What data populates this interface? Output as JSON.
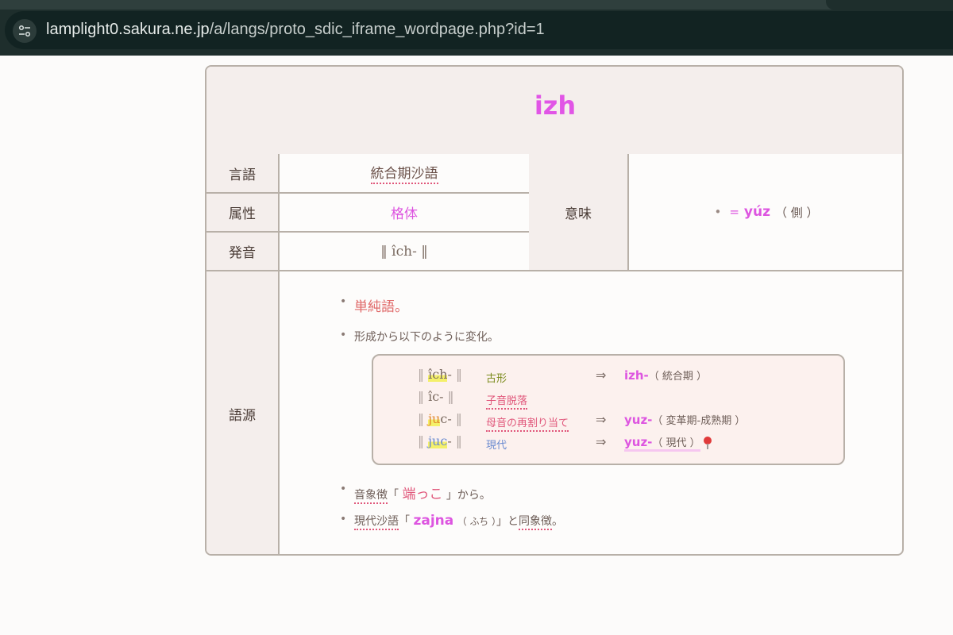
{
  "browser": {
    "url_host": "lamplight0.sakura.ne.jp",
    "url_path": "/a/langs/proto_sdic_iframe_wordpage.php?id=1",
    "site_info_icon": "tune-icon"
  },
  "entry": {
    "headword": "izh",
    "labels": {
      "language": "言語",
      "attribute": "属性",
      "pronunciation": "発音",
      "meaning": "意味",
      "etymology": "語源"
    },
    "language": "統合期沙語",
    "attribute": "格体",
    "pronunciation": "‖ îch- ‖",
    "meaning": {
      "bullet": "•",
      "eq": "=",
      "word": "yúz",
      "gloss": "（ 側 ）"
    }
  },
  "etymology": {
    "item1": "単純語。",
    "item2": "形成から以下のように変化。",
    "evolution": [
      {
        "bar_l": "‖",
        "form_hl": "îch",
        "form_rest": "-",
        "bar_r": "‖",
        "stage": "古形",
        "stage_color": "#7a8a1a",
        "arrow": "⇒",
        "result_word": "izh-",
        "result_period": "（ 統合期 ）"
      },
      {
        "bar_l": "‖",
        "form_hl": "",
        "form_rest": "îc-",
        "bar_r": "‖",
        "stage": "子音脱落",
        "stage_color": "#e0567a",
        "arrow": "",
        "result_word": "",
        "result_period": ""
      },
      {
        "bar_l": "‖",
        "form_hl": "ju",
        "form_rest": "c-",
        "bar_r": "‖",
        "stage": "母音の再割り当て",
        "stage_color": "#e0567a",
        "arrow": "⇒",
        "result_word": "yuz-",
        "result_period": "（ 変革期-成熟期 ）"
      },
      {
        "bar_l": "‖",
        "form_hl": "juc",
        "form_rest": "-",
        "bar_r": "‖",
        "stage": "現代",
        "stage_color": "#6a8ad0",
        "arrow": "⇒",
        "result_word": "yuz-",
        "result_period": "（ 現代 ）",
        "pin_icon": "pushpin-icon"
      }
    ],
    "item3": {
      "prefix": "音象徴",
      "open": "「",
      "word": "端っこ",
      "close": "」",
      "suffix": "から。"
    },
    "item4": {
      "prefix": "現代沙語",
      "open": "「",
      "word": "zajna",
      "gloss": "（ ふち ）",
      "close": "」と",
      "link": "同象徴",
      "end": "。"
    }
  }
}
